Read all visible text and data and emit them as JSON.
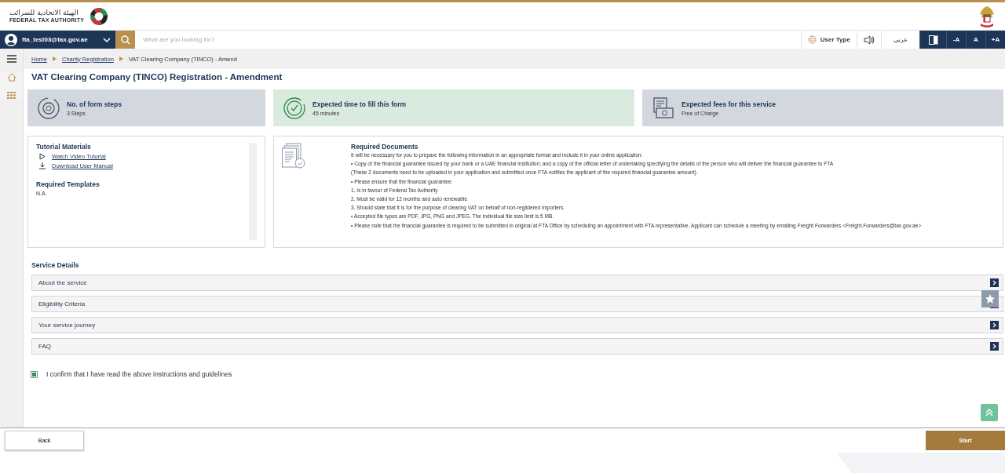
{
  "header": {
    "logo_arabic": "الهيئة الاتحادية للضرائب",
    "logo_english": "FEDERAL TAX AUTHORITY"
  },
  "nav": {
    "user": "fta_test03@tax.gov.ae",
    "search": {
      "placeholder": "What are you looking for?"
    },
    "user_type": "User Type",
    "language": "عربي",
    "font_buttons": [
      "-A",
      "A",
      "+A"
    ]
  },
  "breadcrumb": [
    {
      "label": "Home",
      "link": true
    },
    {
      "label": "Charity Registration",
      "link": true
    },
    {
      "label": "VAT Clearing Company (TINCO) - Amend",
      "link": false
    }
  ],
  "page_title": "VAT Clearing Company (TINCO) Registration - Amendment",
  "info_cards": [
    {
      "kind": "steps",
      "title": "No. of form steps",
      "value": "3 Steps",
      "color": "#d3d8df"
    },
    {
      "kind": "time",
      "title": "Expected time to fill this form",
      "value": "45 minutes",
      "color": "#d9ebdf"
    },
    {
      "kind": "fees",
      "title": "Expected fees for this service",
      "value": "Free of Charge",
      "color": "#d3d8df"
    }
  ],
  "tutorial": {
    "title": "Tutorial Materials",
    "links": [
      {
        "kind": "video",
        "label": "Watch Video Tutorial"
      },
      {
        "kind": "download",
        "label": "Download User Manual"
      }
    ],
    "templates_title": "Required Templates",
    "templates": "N.A."
  },
  "required_documents": {
    "title": "Required Documents",
    "lines": [
      "It will be necessary for you to prepare the following information in an appropriate format and include it in your online application:",
      "• Copy of the financial guarantee issued by your bank or a UAE financial institution; and a copy of the official letter of undertaking specifying the details of the person who will deliver the financial guarantee to FTA",
      "(These 2 documents need to be uploaded in your application and submitted once  FTA notifies the applicant of the required financial guarantee amount).",
      "• Please ensure that the financial guarantee:",
      "1. Is in favour of Federal Tax Authority",
      "2. Must be valid for 12 months and auto renewable",
      "3. Should state that it is for the purpose of clearing VAT on behalf of non-registered importers.",
      "• Accepted file types are PDF, JPG, PNG and JPEG. The individual file size limit is 5 MB.",
      "• Please note that the financial guarantee is required to be submitted in original at FTA Office by scheduling an appointment with FTA representative. Applicant can schedule a meeting by emailing Freight Forwarders <Freight.Forwarders@tax.gov.ae>"
    ]
  },
  "service_details": {
    "title": "Service Details",
    "sections": [
      {
        "label": "About the service",
        "expanded": false
      },
      {
        "label": "Eligibility Criteria",
        "expanded": false
      },
      {
        "label": "Your service journey",
        "expanded": false
      },
      {
        "label": "FAQ",
        "expanded": false
      }
    ]
  },
  "confirm": {
    "label": "I confirm that I have read the above instructions and guidelines",
    "checked": true
  },
  "footer": {
    "back": "Back",
    "start": "Start"
  }
}
